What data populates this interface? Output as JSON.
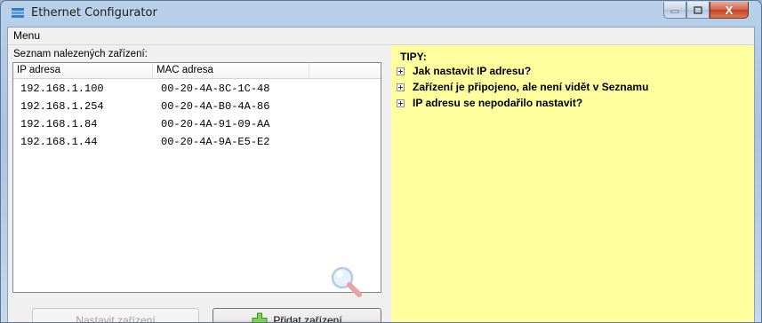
{
  "window": {
    "title": "Ethernet Configurator",
    "close_glyph": "X"
  },
  "menu": {
    "label": "Menu"
  },
  "devices": {
    "label": "Seznam nalezených zařízení:",
    "columns": [
      "IP adresa",
      "MAC adresa"
    ],
    "rows": [
      {
        "ip": "192.168.1.100",
        "mac": "00-20-4A-8C-1C-48"
      },
      {
        "ip": "192.168.1.254",
        "mac": "00-20-4A-B0-4A-86"
      },
      {
        "ip": "192.168.1.84",
        "mac": "00-20-4A-91-09-AA"
      },
      {
        "ip": "192.168.1.44",
        "mac": "00-20-4A-9A-E5-E2"
      }
    ]
  },
  "buttons": {
    "configure": "Nastavit zařízení",
    "add": "Přidat zařízení"
  },
  "tips": {
    "title": "TIPY:",
    "items": [
      "Jak nastavit IP adresu?",
      "Zařízení je připojeno, ale není vidět v Seznamu",
      "IP adresu se nepodařilo nastavit?"
    ]
  },
  "colors": {
    "tips_background": "#ffffa0",
    "add_icon": "#5cbb2c",
    "close_button": "#c44127"
  },
  "icons": {
    "app": "network-icon",
    "watermark": "magnifier-icon",
    "add": "plus-icon"
  }
}
